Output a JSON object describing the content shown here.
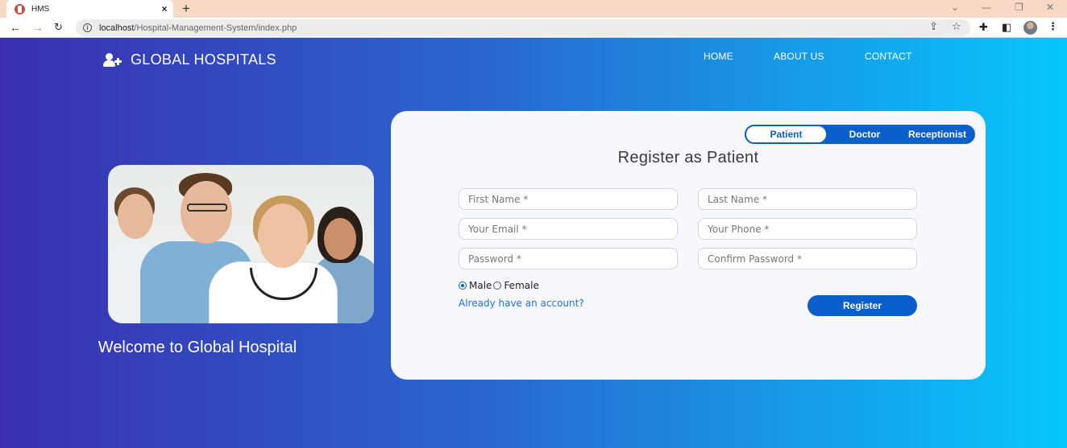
{
  "browser": {
    "tab_title": "HMS",
    "url_host": "localhost",
    "url_path": "/Hospital-Management-System/index.php"
  },
  "site": {
    "brand": "GLOBAL HOSPITALS",
    "nav": [
      "HOME",
      "ABOUT US",
      "CONTACT"
    ],
    "welcome": "Welcome to Global Hospital"
  },
  "form": {
    "roles": [
      "Patient",
      "Doctor",
      "Receptionist"
    ],
    "active_role": "Patient",
    "title": "Register as Patient",
    "placeholders": {
      "first_name": "First Name *",
      "last_name": "Last Name *",
      "email": "Your Email *",
      "phone": "Your Phone *",
      "password": "Password *",
      "confirm_password": "Confirm Password *"
    },
    "gender_options": [
      "Male",
      "Female"
    ],
    "gender_selected": "Male",
    "login_link": "Already have an account?",
    "submit_label": "Register"
  },
  "colors": {
    "accent": "#0b5fcc",
    "link": "#1f73d8",
    "gradient_start": "#3a2fb0",
    "gradient_end": "#06c7fb"
  }
}
